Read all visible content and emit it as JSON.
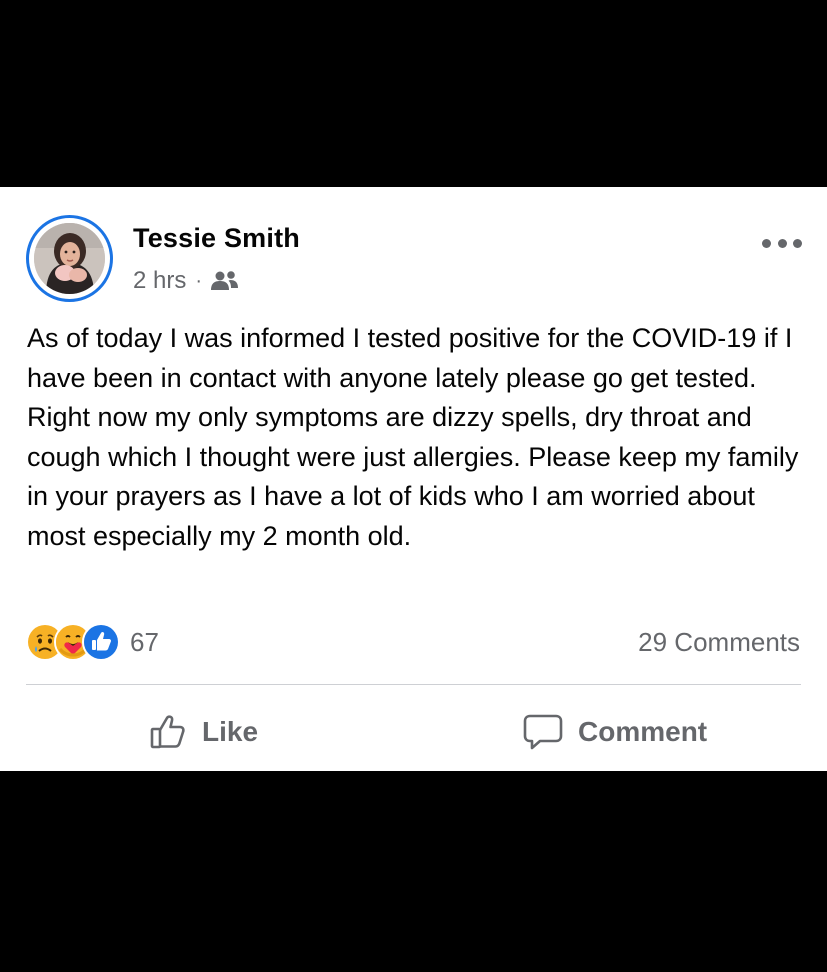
{
  "post": {
    "author": "Tessie Smith",
    "time": "2 hrs",
    "separator": "·",
    "audience_icon": "friends-icon",
    "more_icon": "more-dots-icon",
    "text": "As of today I was informed I tested positive for the COVID-19 if I have been in contact with anyone lately please go get tested. Right now my only symptoms are dizzy spells, dry throat and cough which I thought were just allergies. Please keep my family in your prayers as I have a lot of kids who I am worried about most especially my 2 month old."
  },
  "reactions": {
    "icons": [
      "sad-icon",
      "care-icon",
      "like-icon"
    ],
    "count": "67",
    "comments": "29 Comments"
  },
  "actions": {
    "like_label": "Like",
    "comment_label": "Comment"
  },
  "colors": {
    "accent": "#1b74e4",
    "secondary_text": "#65676b",
    "primary_text": "#050505",
    "reaction_yellow": "#f7b125"
  }
}
